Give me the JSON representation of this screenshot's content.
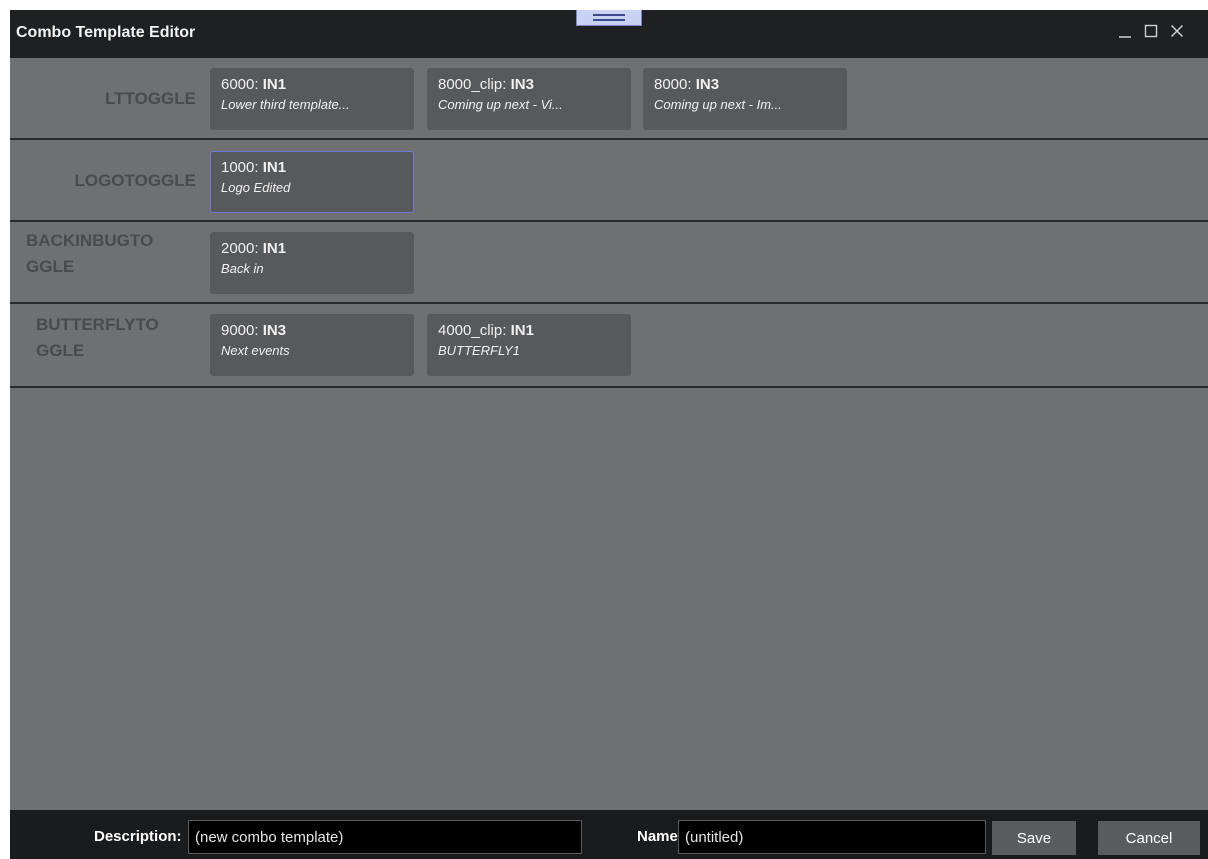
{
  "window": {
    "title": "Combo Template Editor",
    "controls": {
      "minimize": "_",
      "maximize": "□",
      "close": "X"
    }
  },
  "rows": [
    {
      "label_lines": [
        "LTTOGGLE"
      ],
      "cards": [
        {
          "code": "6000:",
          "input": "IN1",
          "desc": "Lower third template..."
        },
        {
          "code": "8000_clip:",
          "input": "IN3",
          "desc": "Coming up next - Vi..."
        },
        {
          "code": "8000:",
          "input": "IN3",
          "desc": "Coming up next - Im..."
        }
      ]
    },
    {
      "label_lines": [
        "LOGOTOGGLE"
      ],
      "cards": [
        {
          "code": "1000:",
          "input": "IN1",
          "desc": "Logo Edited",
          "selected": true
        }
      ]
    },
    {
      "label_lines": [
        "BACKINBUGTO",
        "GGLE"
      ],
      "cards": [
        {
          "code": "2000:",
          "input": "IN1",
          "desc": "Back in"
        }
      ]
    },
    {
      "label_lines": [
        "BUTTERFLYTO",
        "GGLE"
      ],
      "cards": [
        {
          "code": "9000:",
          "input": "IN3",
          "desc": "Next events"
        },
        {
          "code": "4000_clip:",
          "input": "IN1",
          "desc": "BUTTERFLY1"
        }
      ]
    }
  ],
  "footer": {
    "description_label": "Description:",
    "description_value": "(new combo template)",
    "name_label": "Name:",
    "name_value": "(untitled)",
    "save_label": "Save",
    "cancel_label": "Cancel"
  },
  "colors": {
    "background": "#6f7072",
    "titlebar": "#1f2022",
    "card": "#58595b",
    "selected_border": "#6d79d6",
    "row_label": "#4a4b4e"
  }
}
